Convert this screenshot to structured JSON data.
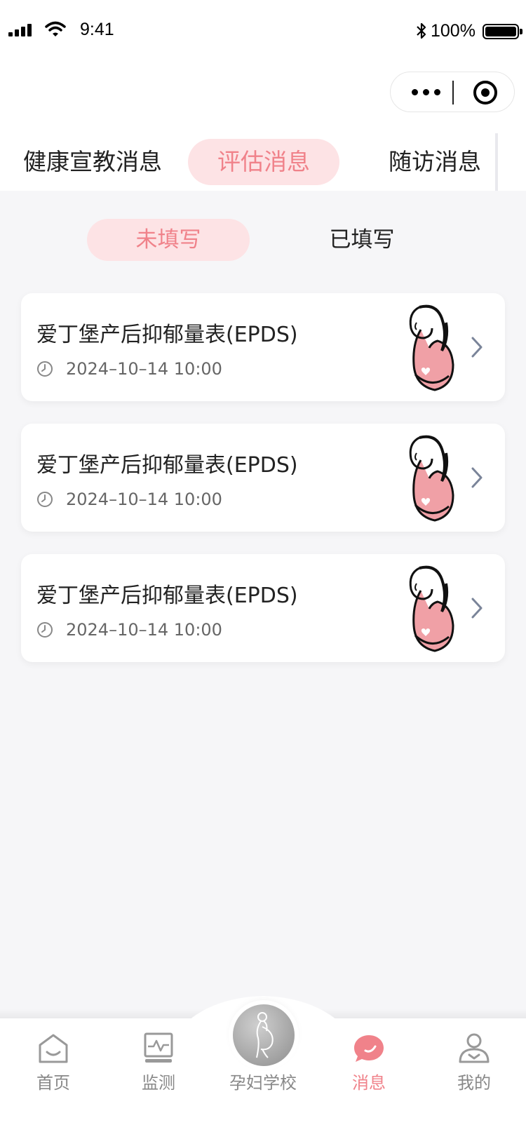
{
  "status_bar": {
    "time": "9:41",
    "battery_percent": "100%"
  },
  "capsule": {
    "more_icon": "more-dots-icon",
    "close_icon": "target-circle-icon"
  },
  "top_tabs": [
    {
      "label": "健康宣教消息",
      "active": false
    },
    {
      "label": "评估消息",
      "active": true
    },
    {
      "label": "随访消息",
      "active": false
    }
  ],
  "sub_tabs": [
    {
      "label": "未填写",
      "active": true
    },
    {
      "label": "已填写",
      "active": false
    }
  ],
  "cards": [
    {
      "title": "爱丁堡产后抑郁量表(EPDS)",
      "time": "2024–10–14 10:00"
    },
    {
      "title": "爱丁堡产后抑郁量表(EPDS)",
      "time": "2024–10–14 10:00"
    },
    {
      "title": "爱丁堡产后抑郁量表(EPDS)",
      "time": "2024–10–14 10:00"
    }
  ],
  "bottom_nav": [
    {
      "label": "首页",
      "icon": "home-icon",
      "active": false
    },
    {
      "label": "监测",
      "icon": "monitor-icon",
      "active": false
    },
    {
      "label": "孕妇学校",
      "icon": "pregnant-woman-icon",
      "active": false
    },
    {
      "label": "消息",
      "icon": "message-bubble-icon",
      "active": true
    },
    {
      "label": "我的",
      "icon": "profile-icon",
      "active": false
    }
  ],
  "colors": {
    "accent": "#f0828a",
    "accent_bg": "#fde3e5",
    "page_bg": "#f6f6f8"
  }
}
